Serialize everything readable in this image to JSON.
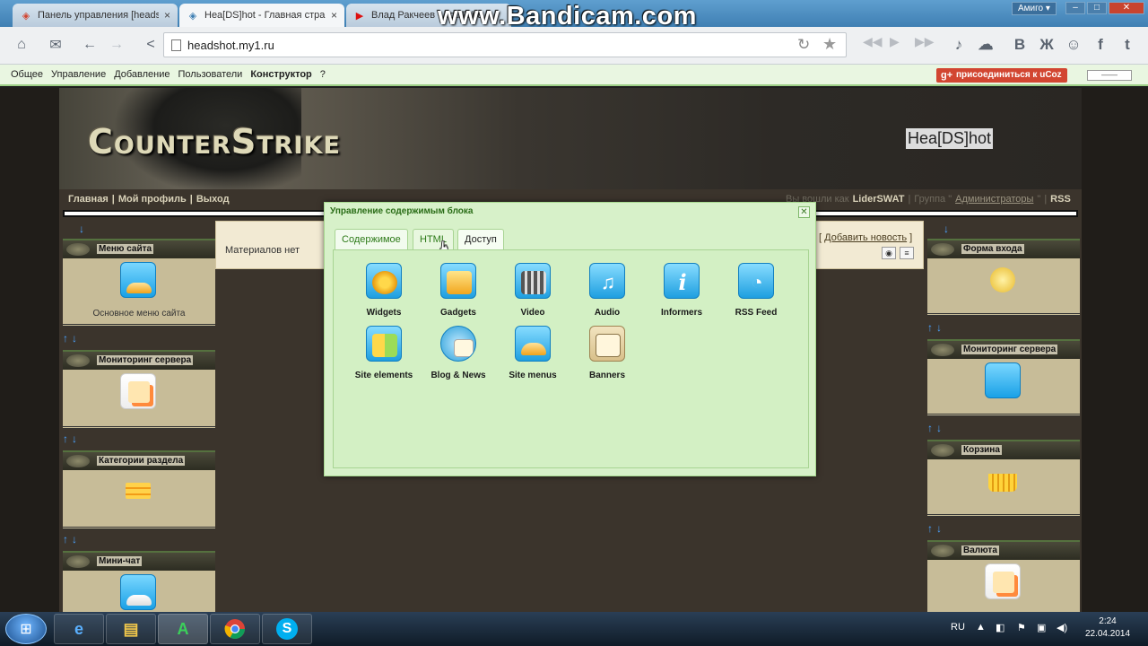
{
  "browser": {
    "tabs": [
      {
        "label": "Панель управления [heads",
        "icon": "ucoz-icon"
      },
      {
        "label": "Hea[DS]hot - Главная стран",
        "icon": "ucoz-icon"
      },
      {
        "label": "Влад Ракчеев - YouTube",
        "icon": "youtube-icon"
      }
    ],
    "watermark": "www.Bandicam.com",
    "user": "Амиго",
    "url": "headshot.my1.ru"
  },
  "ucoz_bar": {
    "menu": [
      "Общее",
      "Управление",
      "Добавление",
      "Пользователи",
      "Конструктор",
      "?"
    ],
    "join_label": "присоединиться к uCoz"
  },
  "site": {
    "logo": "CounterStrike",
    "name": "Hea[DS]hot",
    "nav": [
      "Главная",
      "Мой профиль",
      "Выход"
    ],
    "login_text_prefix": "Вы вошли как",
    "login_user": "LiderSWAT",
    "group_prefix": "Группа \"",
    "group_name": "Администраторы",
    "group_suffix": "\"",
    "rss": "RSS",
    "left_blocks": [
      {
        "title": "Меню сайта",
        "caption": "Основное меню сайта"
      },
      {
        "title": "Мониторинг сервера",
        "caption": ""
      },
      {
        "title": "Категории раздела",
        "caption": ""
      },
      {
        "title": "Мини-чат",
        "caption": ""
      }
    ],
    "right_blocks": [
      {
        "title": "Форма входа"
      },
      {
        "title": "Мониторинг сервера"
      },
      {
        "title": "Корзина"
      },
      {
        "title": "Валюта"
      }
    ],
    "content": {
      "no_materials": "Материалов нет",
      "add_news": "Добавить новость"
    }
  },
  "dialog": {
    "title": "Управление содержимым блока",
    "tabs": [
      "Содержимое",
      "HTML",
      "Доступ"
    ],
    "tiles": [
      {
        "label": "Widgets",
        "icon": "widgets-icon"
      },
      {
        "label": "Gadgets",
        "icon": "gadgets-icon"
      },
      {
        "label": "Video",
        "icon": "video-icon"
      },
      {
        "label": "Audio",
        "icon": "audio-icon"
      },
      {
        "label": "Informers",
        "icon": "informers-icon"
      },
      {
        "label": "RSS Feed",
        "icon": "rss-icon"
      },
      {
        "label": "Site elements",
        "icon": "site-elements-icon"
      },
      {
        "label": "Blog & News",
        "icon": "blog-news-icon"
      },
      {
        "label": "Site menus",
        "icon": "site-menus-icon"
      },
      {
        "label": "Banners",
        "icon": "banners-icon"
      }
    ]
  },
  "taskbar": {
    "lang": "RU",
    "time": "2:24",
    "date": "22.04.2014"
  }
}
